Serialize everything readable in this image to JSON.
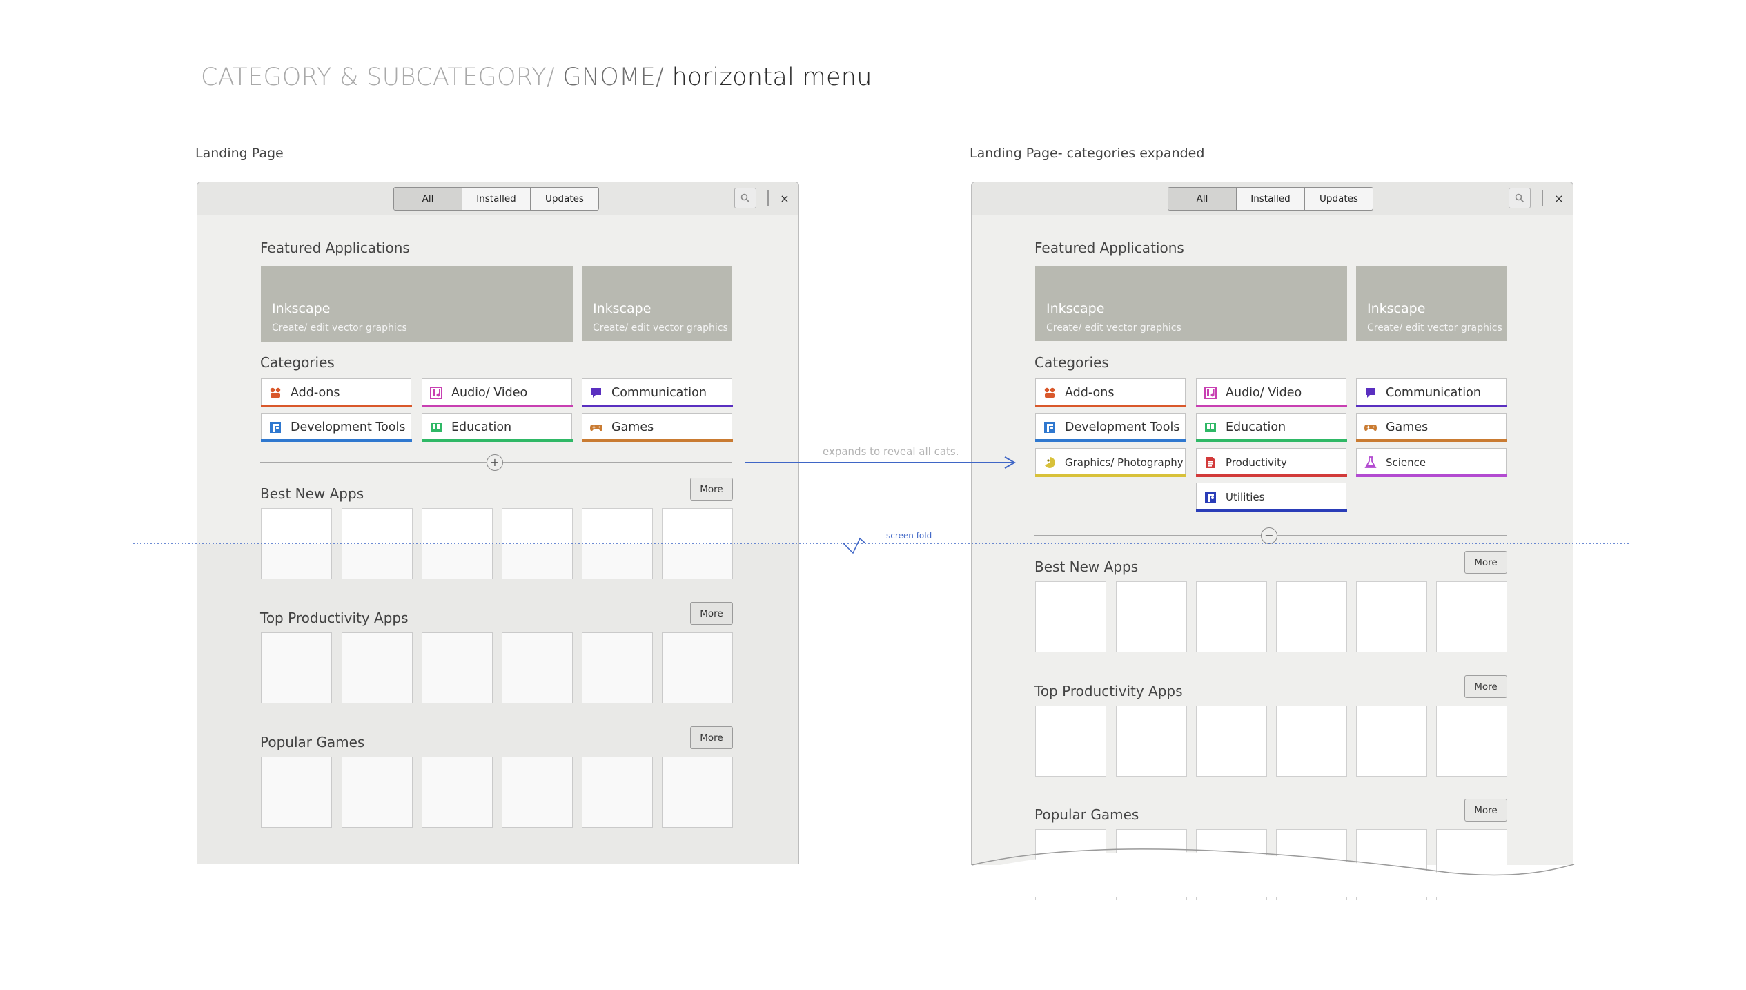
{
  "title": {
    "part1": "CATEGORY & SUBCATEGORY/ ",
    "part2": "GNOME/ ",
    "part3": "horizontal menu"
  },
  "mockups": [
    {
      "label": "Landing Page",
      "tabs": [
        "All",
        "Installed",
        "Updates"
      ],
      "active_tab": "All",
      "featured_title": "Featured Applications",
      "featured": [
        {
          "name": "Inkscape",
          "desc": "Create/ edit vector graphics"
        },
        {
          "name": "Inkscape",
          "desc": "Create/ edit vector graphics"
        }
      ],
      "categories_title": "Categories",
      "categories": [
        {
          "label": "Add-ons",
          "color": "#d9582b",
          "icon": "addons-icon"
        },
        {
          "label": "Audio/ Video",
          "color": "#c83fb2",
          "icon": "audio-video-icon"
        },
        {
          "label": "Communication",
          "color": "#5a2fc0",
          "icon": "communication-icon"
        },
        {
          "label": "Development Tools",
          "color": "#2f78cf",
          "icon": "development-tools-icon"
        },
        {
          "label": "Education",
          "color": "#2fb866",
          "icon": "education-icon"
        },
        {
          "label": "Games",
          "color": "#c97b32",
          "icon": "games-icon"
        }
      ],
      "expand_toggle": "+",
      "sections": [
        {
          "title": "Best New Apps",
          "more": "More"
        },
        {
          "title": "Top Productivity Apps",
          "more": "More"
        },
        {
          "title": "Popular Games",
          "more": "More"
        }
      ]
    },
    {
      "label": "Landing Page- categories expanded",
      "tabs": [
        "All",
        "Installed",
        "Updates"
      ],
      "active_tab": "All",
      "featured_title": "Featured Applications",
      "featured": [
        {
          "name": "Inkscape",
          "desc": "Create/ edit vector graphics"
        },
        {
          "name": "Inkscape",
          "desc": "Create/ edit vector graphics"
        }
      ],
      "categories_title": "Categories",
      "categories": [
        {
          "label": "Add-ons",
          "color": "#d9582b",
          "icon": "addons-icon"
        },
        {
          "label": "Audio/ Video",
          "color": "#c83fb2",
          "icon": "audio-video-icon"
        },
        {
          "label": "Communication",
          "color": "#5a2fc0",
          "icon": "communication-icon"
        },
        {
          "label": "Development Tools",
          "color": "#2f78cf",
          "icon": "development-tools-icon"
        },
        {
          "label": "Education",
          "color": "#2fb866",
          "icon": "education-icon"
        },
        {
          "label": "Games",
          "color": "#c97b32",
          "icon": "games-icon"
        },
        {
          "label": "Graphics/ Photography",
          "color": "#d8c13a",
          "icon": "graphics-photography-icon"
        },
        {
          "label": "Productivity",
          "color": "#d23a3a",
          "icon": "productivity-icon"
        },
        {
          "label": "Science",
          "color": "#b34bd1",
          "icon": "science-icon"
        },
        {
          "label": "Utilities",
          "color": "#2a3db8",
          "icon": "utilities-icon"
        }
      ],
      "expand_toggle": "−",
      "sections": [
        {
          "title": "Best New Apps",
          "more": "More"
        },
        {
          "title": "Top Productivity Apps",
          "more": "More"
        },
        {
          "title": "Popular Games",
          "more": "More"
        }
      ]
    }
  ],
  "annotations": {
    "expands": "expands to reveal all cats.",
    "screen_fold": "screen fold"
  },
  "colors": {
    "annotation_blue": "#3f66c6",
    "feature_grey": "#b8b9b1",
    "window_bg": "#efefed"
  }
}
